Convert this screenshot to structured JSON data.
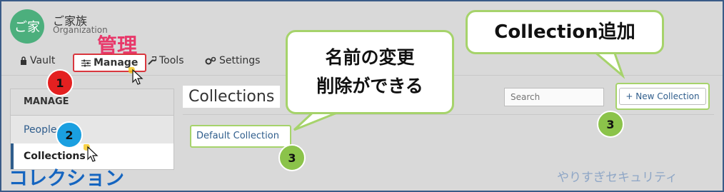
{
  "org": {
    "avatar_text": "ご家",
    "name": "ご家族",
    "subtitle": "Organization"
  },
  "nav": {
    "vault": "Vault",
    "manage": "Manage",
    "tools": "Tools",
    "settings": "Settings"
  },
  "sidebar": {
    "header": "MANAGE",
    "items": [
      {
        "label": "People"
      },
      {
        "label": "Collections"
      }
    ]
  },
  "main": {
    "title": "Collections",
    "search_placeholder": "Search",
    "new_collection_label": "New Collection",
    "collections": [
      {
        "name": "Default Collection"
      }
    ]
  },
  "annotations": {
    "manage_label": "管理",
    "collections_label": "コレクション",
    "bubble_rename_line1": "名前の変更",
    "bubble_rename_line2": "削除ができる",
    "bubble_add": "Collection追加",
    "step_1": "1",
    "step_2": "2",
    "step_3a": "3",
    "step_3b": "3",
    "watermark": "やりすぎセキュリティ"
  },
  "colors": {
    "accent_green": "#a6d36b",
    "link_blue": "#2f5d8c",
    "highlight_red": "#d9363e",
    "avatar_green": "#4caf7d"
  },
  "icons": [
    "lock-icon",
    "sliders-icon",
    "wrench-icon",
    "gears-icon",
    "plus-icon",
    "cursor-icon"
  ]
}
